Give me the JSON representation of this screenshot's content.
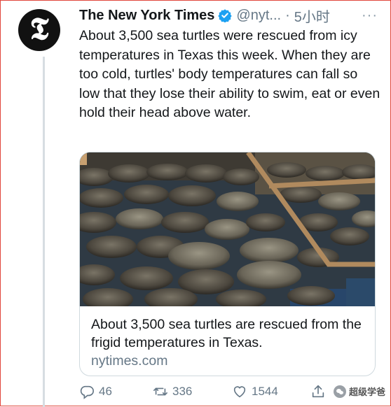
{
  "tweet": {
    "author_name": "The New York Times",
    "avatar_letter": "𝕿",
    "handle": "@nyt...",
    "separator": "·",
    "time": "5小时",
    "more": "···",
    "text": "About 3,500 sea turtles were rescued from icy temperatures in Texas this week. When they are too cold, turtles' body temperatures can fall so low that they lose their ability to swim, eat or even hold their head above water."
  },
  "card": {
    "title": "About 3,500 sea turtles are rescued from the frigid temperatures in Texas.",
    "domain": "nytimes.com",
    "image_icon": "sea-turtles-photo"
  },
  "actions": {
    "reply_count": "46",
    "retweet_count": "336",
    "like_count": "1544",
    "share_icon": "share-icon"
  },
  "watermark": {
    "text": "超级学爸"
  },
  "colors": {
    "verified": "#1da1f2",
    "muted": "#657786",
    "border": "#e0463c"
  }
}
